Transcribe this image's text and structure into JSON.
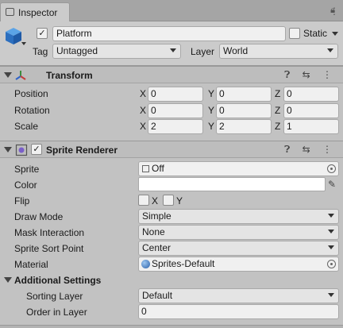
{
  "tab": {
    "label": "Inspector"
  },
  "header": {
    "name_value": "Platform",
    "static_label": "Static",
    "tag_label": "Tag",
    "tag_value": "Untagged",
    "layer_label": "Layer",
    "layer_value": "World"
  },
  "transform": {
    "title": "Transform",
    "rows": [
      {
        "label": "Position",
        "x": "0",
        "y": "0",
        "z": "0"
      },
      {
        "label": "Rotation",
        "x": "0",
        "y": "0",
        "z": "0"
      },
      {
        "label": "Scale",
        "x": "2",
        "y": "2",
        "z": "1"
      }
    ],
    "axes": {
      "x": "X",
      "y": "Y",
      "z": "Z"
    }
  },
  "sprite_renderer": {
    "title": "Sprite Renderer",
    "sprite_label": "Sprite",
    "sprite_value": "Off",
    "color_label": "Color",
    "color_value": "#ffffff",
    "flip_label": "Flip",
    "flip_x": "X",
    "flip_y": "Y",
    "draw_mode_label": "Draw Mode",
    "draw_mode_value": "Simple",
    "mask_label": "Mask Interaction",
    "mask_value": "None",
    "sort_point_label": "Sprite Sort Point",
    "sort_point_value": "Center",
    "material_label": "Material",
    "material_value": "Sprites-Default",
    "additional_label": "Additional Settings",
    "sorting_layer_label": "Sorting Layer",
    "sorting_layer_value": "Default",
    "order_label": "Order in Layer",
    "order_value": "0"
  }
}
